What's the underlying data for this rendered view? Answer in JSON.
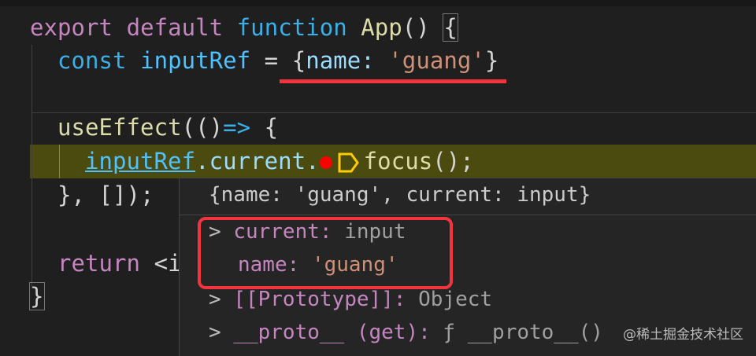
{
  "editor": {
    "lines": [
      {
        "t1": "export",
        "t2": "default",
        "t3": "function",
        "t4": "App",
        "t5": "()",
        "t6": "{"
      },
      {
        "t1": "const",
        "t2": "inputRef",
        "t3": "=",
        "t4": "{",
        "t5": "name:",
        "t6": "'guang'",
        "t7": "}"
      },
      {
        "t1": "useEffect",
        "t2": "(()",
        "t3": "=>",
        "t4": "{"
      },
      {
        "t1": "inputRef",
        "t2": ".current.",
        "t3": "focus",
        "t4": "();"
      },
      {
        "t1": "}, []);"
      },
      {
        "t1": "return",
        "t2": "<i"
      },
      {
        "t1": "}"
      }
    ]
  },
  "hover": {
    "summary": "{name: 'guang', current: input}",
    "rows": [
      {
        "chevron": ">",
        "key": "current:",
        "value": "input"
      },
      {
        "key": "name:",
        "value": "'guang'"
      },
      {
        "chevron": ">",
        "key": "[[Prototype]]:",
        "value": "Object"
      },
      {
        "chevron": ">",
        "key": "__proto__ (get):",
        "value": "ƒ __proto__()"
      }
    ]
  },
  "watermark": "@稀土掘金技术社区",
  "colors": {
    "annotation": "#f2343f",
    "debug_line": "#4b4b0f",
    "breakpoint": "#ff0000"
  }
}
